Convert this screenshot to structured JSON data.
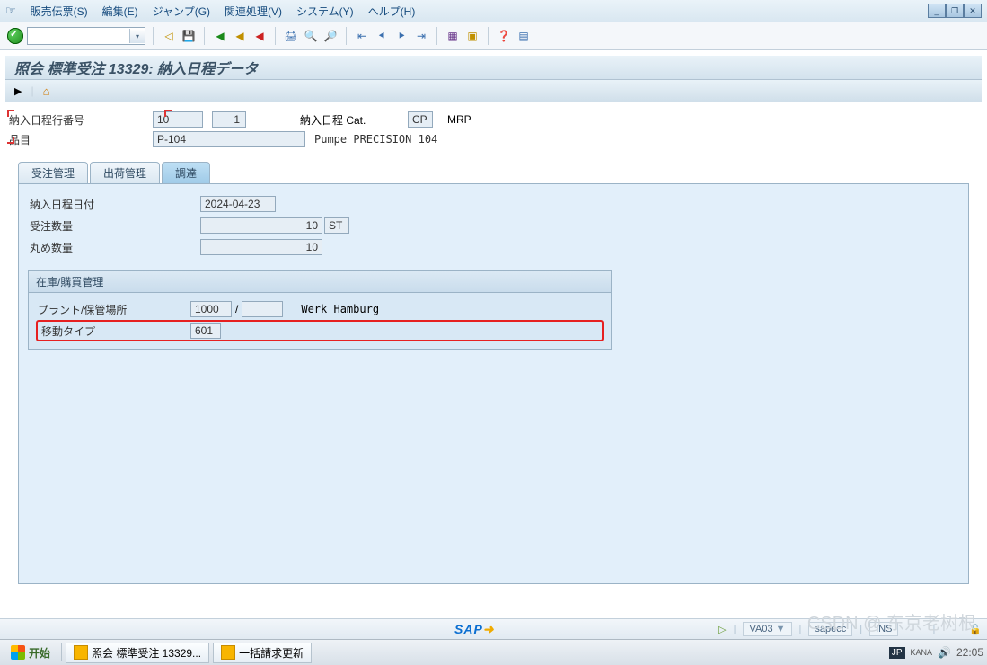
{
  "menu": {
    "items": [
      "販売伝票(S)",
      "編集(E)",
      "ジャンプ(G)",
      "関連処理(V)",
      "システム(Y)",
      "ヘルプ(H)"
    ]
  },
  "title": "照会 標準受注 13329: 納入日程データ",
  "header": {
    "schedLineNo_label": "納入日程行番号",
    "schedLineNo_val1": "10",
    "schedLineNo_val2": "1",
    "schedCat_label": "納入日程 Cat.",
    "schedCat_val": "CP",
    "schedCat_text": "MRP",
    "item_label": "品目",
    "item_val": "P-104",
    "item_text": "Pumpe PRECISION 104"
  },
  "tabs": [
    "受注管理",
    "出荷管理",
    "調達"
  ],
  "proc": {
    "date_label": "納入日程日付",
    "date_val": "2024-04-23",
    "orderqty_label": "受注数量",
    "orderqty_val": "10",
    "orderqty_unit": "ST",
    "roundqty_label": "丸め数量",
    "roundqty_val": "10",
    "group_title": "在庫/購買管理",
    "plant_label": "プラント/保管場所",
    "plant_val": "1000",
    "plant_sep": "/",
    "storloc_val": "",
    "plant_text": "Werk Hamburg",
    "movtype_label": "移動タイプ",
    "movtype_val": "601"
  },
  "footer": {
    "sap": "SAP",
    "nav_arrow": "▷",
    "tcode": "VA03",
    "drop": "▼",
    "system": "sapecc",
    "mode": "INS"
  },
  "taskbar": {
    "start": "开始",
    "task1": "照会 標準受注 13329...",
    "task2": "一括請求更新",
    "lang": "JP",
    "kana": "KANA",
    "time": "22:05"
  },
  "watermark": "CSDN @ 东京老树根"
}
